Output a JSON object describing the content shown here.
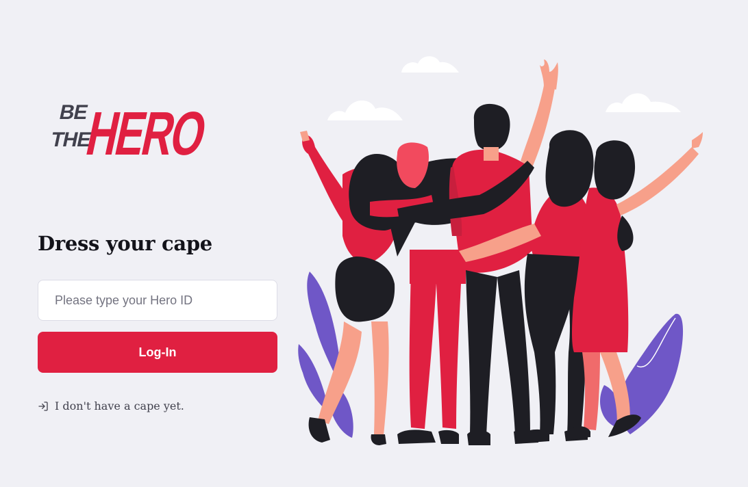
{
  "logo": {
    "line1": "BE",
    "line2": "THE",
    "line3": "HERO"
  },
  "form": {
    "title": "Dress your cape",
    "input_placeholder": "Please type your Hero ID",
    "login_label": "Log-In",
    "register_link": "I don't have a cape yet."
  },
  "colors": {
    "brand": "#e02041",
    "background": "#f0f0f5",
    "text_dark": "#13131a",
    "plant": "#6f57c7"
  },
  "icons": {
    "register": "log-in-icon"
  }
}
